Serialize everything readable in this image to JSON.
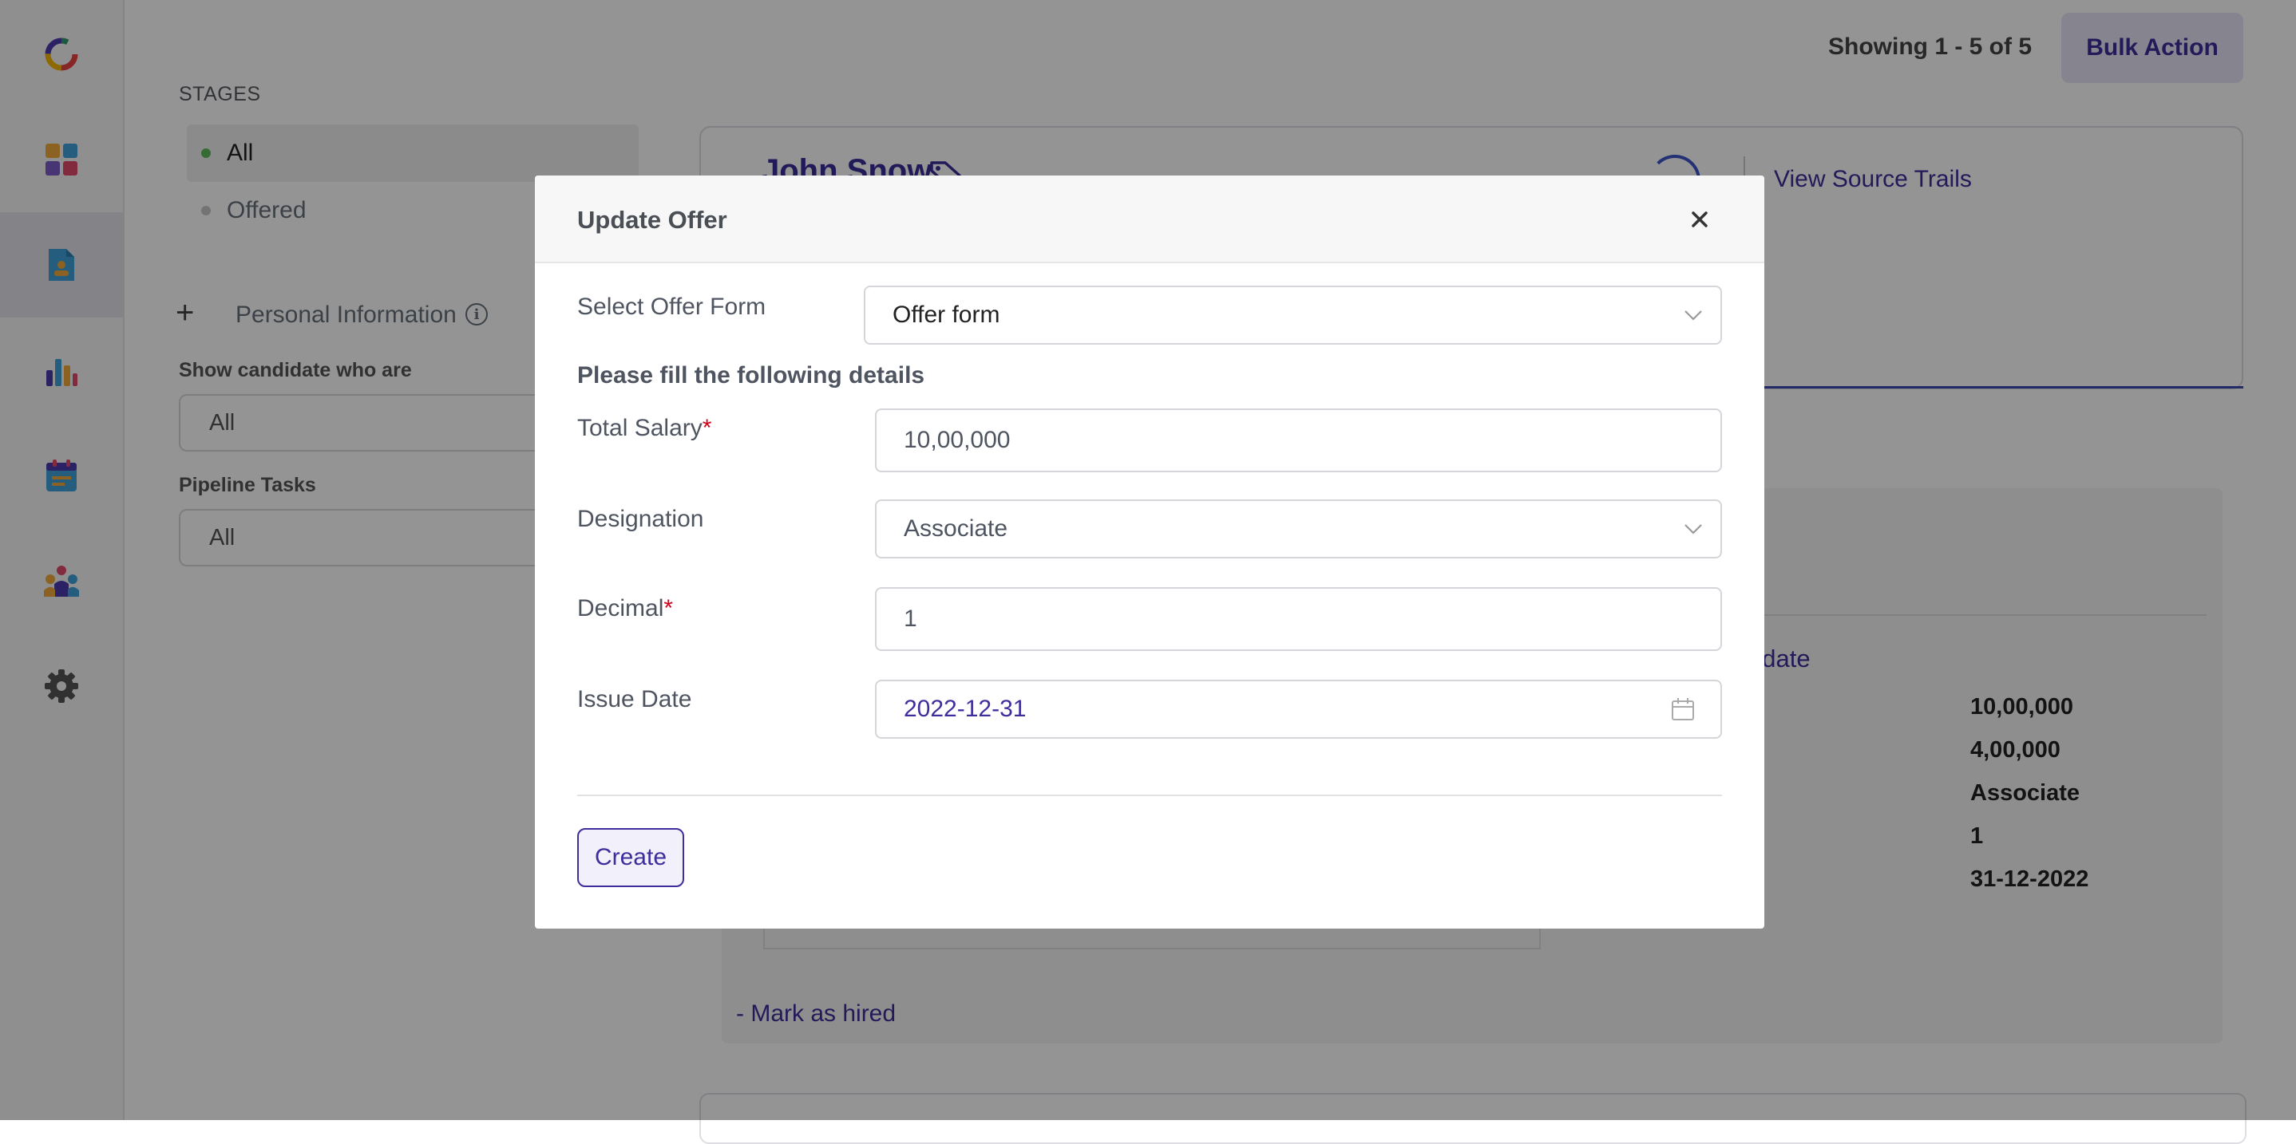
{
  "sidebar": {
    "items": [
      {
        "icon": "app-logo-icon"
      },
      {
        "icon": "dashboard-icon"
      },
      {
        "icon": "candidates-icon",
        "active": true
      },
      {
        "icon": "reports-icon"
      },
      {
        "icon": "calendar-icon"
      },
      {
        "icon": "team-icon"
      },
      {
        "icon": "settings-icon"
      }
    ]
  },
  "filters": {
    "stages_title": "STAGES",
    "stages": [
      {
        "label": "All",
        "active": true,
        "dot_color": "#5cb85c"
      },
      {
        "label": "Offered",
        "active": false,
        "dot_color": "#c8c8c8"
      }
    ],
    "add_label": "+",
    "personal_info_label": "Personal Information",
    "show_candidate_label": "Show candidate who are",
    "show_candidate_value": "All",
    "pipeline_tasks_label": "Pipeline Tasks",
    "pipeline_tasks_value": "All"
  },
  "header": {
    "showing_text": "Showing 1 - 5 of 5",
    "bulk_action_label": "Bulk Action"
  },
  "candidate": {
    "name": "John Snow",
    "view_source_trails": "View Source Trails",
    "update_link": "odate",
    "details": [
      "10,00,000",
      "4,00,000",
      "Associate",
      "1",
      "31-12-2022"
    ],
    "mark_as_hired": "- Mark as hired"
  },
  "modal": {
    "title": "Update Offer",
    "close_symbol": "✕",
    "select_form_label": "Select Offer Form",
    "select_form_value": "Offer form",
    "section_heading": "Please fill the following details",
    "total_salary_label": "Total Salary",
    "total_salary_value": "10,00,000",
    "designation_label": "Designation",
    "designation_value": "Associate",
    "decimal_label": "Decimal",
    "decimal_value": "1",
    "issue_date_label": "Issue Date",
    "issue_date_value": "2022-12-31",
    "required_mark": "*",
    "create_label": "Create"
  },
  "colors": {
    "accent": "#3d2e9c",
    "required": "#d0021b",
    "overlay": "rgba(0,0,0,0.42)"
  }
}
